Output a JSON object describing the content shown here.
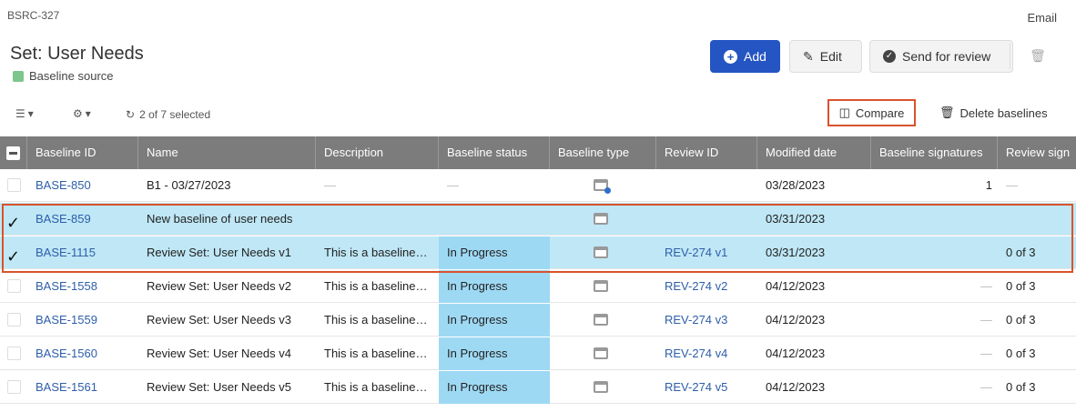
{
  "page": {
    "key": "BSRC-327",
    "user_menu": "Email",
    "title": "Set: User Needs",
    "subtitle": "Baseline source"
  },
  "actions": {
    "add": "Add",
    "edit": "Edit",
    "send_for_review": "Send for review"
  },
  "toolbar": {
    "selection": "2 of 7 selected",
    "compare": "Compare",
    "delete_baselines": "Delete baselines"
  },
  "columns": [
    "Baseline ID",
    "Name",
    "Description",
    "Baseline status",
    "Baseline type",
    "Review ID",
    "Modified date",
    "Baseline signatures",
    "Review signatures"
  ],
  "columns_visible": [
    "Baseline ID",
    "Name",
    "Description",
    "Baseline status",
    "Baseline type",
    "Review ID",
    "Modified date",
    "Baseline signatures",
    "Review sign"
  ],
  "rows": [
    {
      "selected": false,
      "id": "BASE-850",
      "name": "B1 - 03/27/2023",
      "description": "—",
      "status": "—",
      "type_icon": "baseline-source-icon",
      "review_id": "",
      "modified": "03/28/2023",
      "baseline_sigs": "1",
      "review_sigs": "—"
    },
    {
      "selected": true,
      "id": "BASE-859",
      "name": "New baseline of user needs",
      "description": "",
      "status": "",
      "type_icon": "baseline-icon",
      "review_id": "",
      "modified": "03/31/2023",
      "baseline_sigs": "",
      "review_sigs": ""
    },
    {
      "selected": true,
      "id": "BASE-1115",
      "name": "Review Set: User Needs v1",
      "description": "This is a baseline…",
      "status": "In Progress",
      "type_icon": "baseline-icon",
      "review_id": "REV-274 v1",
      "modified": "03/31/2023",
      "baseline_sigs": "",
      "review_sigs": "0 of 3"
    },
    {
      "selected": false,
      "id": "BASE-1558",
      "name": "Review Set: User Needs v2",
      "description": "This is a baseline…",
      "status": "In Progress",
      "type_icon": "baseline-icon",
      "review_id": "REV-274 v2",
      "modified": "04/12/2023",
      "baseline_sigs": "—",
      "review_sigs": "0 of 3"
    },
    {
      "selected": false,
      "id": "BASE-1559",
      "name": "Review Set: User Needs v3",
      "description": "This is a baseline…",
      "status": "In Progress",
      "type_icon": "baseline-icon",
      "review_id": "REV-274 v3",
      "modified": "04/12/2023",
      "baseline_sigs": "—",
      "review_sigs": "0 of 3"
    },
    {
      "selected": false,
      "id": "BASE-1560",
      "name": "Review Set: User Needs v4",
      "description": "This is a baseline…",
      "status": "In Progress",
      "type_icon": "baseline-icon",
      "review_id": "REV-274 v4",
      "modified": "04/12/2023",
      "baseline_sigs": "—",
      "review_sigs": "0 of 3"
    },
    {
      "selected": false,
      "id": "BASE-1561",
      "name": "Review Set: User Needs v5",
      "description": "This is a baseline…",
      "status": "In Progress",
      "type_icon": "baseline-icon",
      "review_id": "REV-274 v5",
      "modified": "04/12/2023",
      "baseline_sigs": "—",
      "review_sigs": "0 of 3"
    }
  ],
  "colors": {
    "primary": "#2455c3",
    "header_bg": "#7c7c7c",
    "selected_row": "#bfe7f6",
    "status_cell": "#9ed9f4",
    "highlight_box": "#d9532c",
    "link": "#2e5ea9"
  }
}
